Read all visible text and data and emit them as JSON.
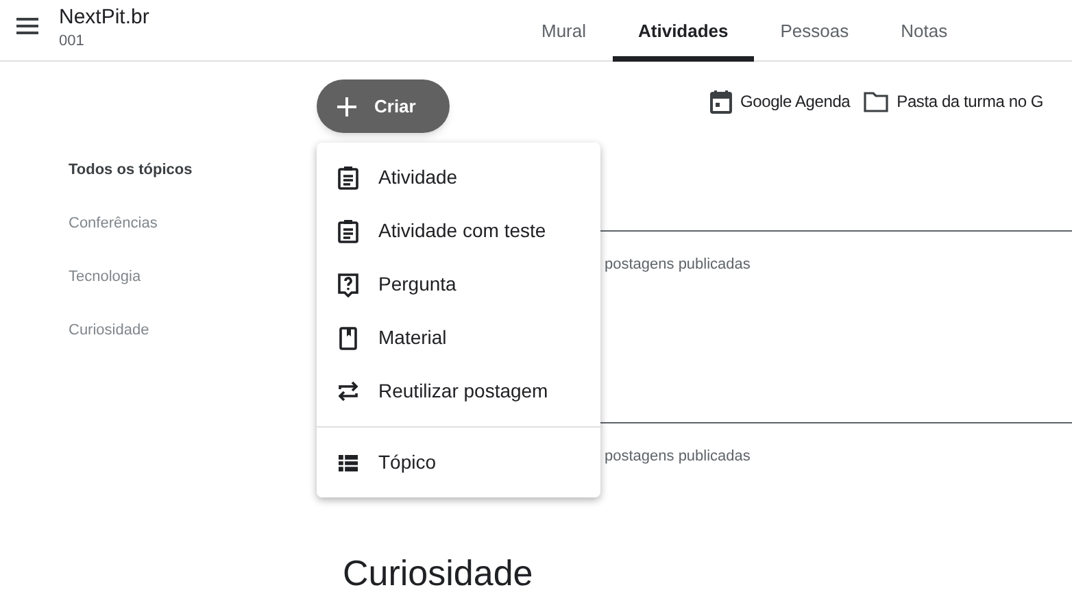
{
  "header": {
    "title": "NextPit.br",
    "subtitle": "001"
  },
  "tabs": [
    {
      "label": "Mural",
      "selected": false
    },
    {
      "label": "Atividades",
      "selected": true
    },
    {
      "label": "Pessoas",
      "selected": false
    },
    {
      "label": "Notas",
      "selected": false
    }
  ],
  "create_button": {
    "label": "Criar"
  },
  "links": [
    {
      "kind": "calendar",
      "label": "Google Agenda"
    },
    {
      "kind": "folder",
      "label": "Pasta da turma no G"
    }
  ],
  "topics": [
    {
      "label": "Todos os tópicos",
      "selected": true
    },
    {
      "label": "Conferências",
      "selected": false
    },
    {
      "label": "Tecnologia",
      "selected": false
    },
    {
      "label": "Curiosidade",
      "selected": false
    }
  ],
  "sections": [
    {
      "summary": "postagens publicadas"
    },
    {
      "summary": "postagens publicadas"
    }
  ],
  "heading": "Curiosidade",
  "menu": {
    "groups": [
      [
        {
          "kind": "assignment",
          "label": "Atividade"
        },
        {
          "kind": "quiz",
          "label": "Atividade com teste"
        },
        {
          "kind": "question",
          "label": "Pergunta"
        },
        {
          "kind": "material",
          "label": "Material"
        },
        {
          "kind": "reuse",
          "label": "Reutilizar postagem"
        }
      ],
      [
        {
          "kind": "topic",
          "label": "Tópico"
        }
      ]
    ]
  }
}
